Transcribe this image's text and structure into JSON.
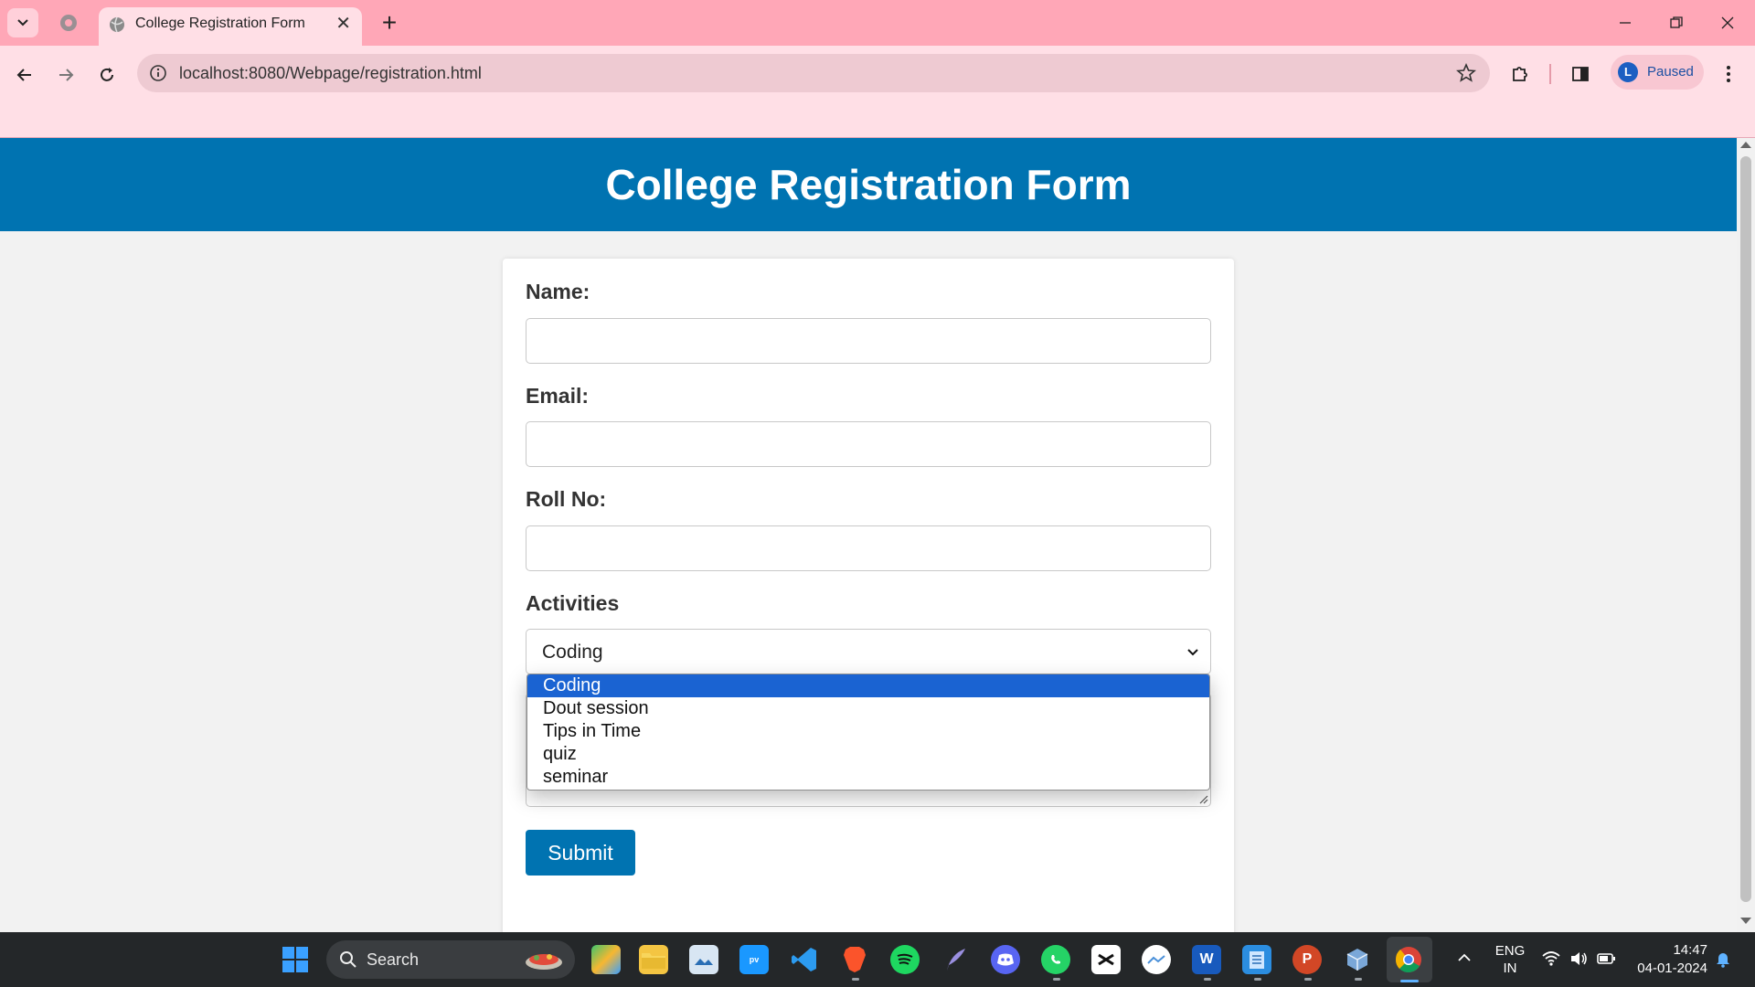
{
  "browser": {
    "tab_title": "College Registration Form",
    "url": "localhost:8080/Webpage/registration.html",
    "profile_initial": "L",
    "profile_status": "Paused"
  },
  "page": {
    "title": "College Registration Form",
    "form": {
      "name_label": "Name:",
      "email_label": "Email:",
      "roll_label": "Roll No:",
      "activities_label": "Activities",
      "activities_selected": "Coding",
      "activities_options": [
        "Coding",
        "Dout session",
        "Tips in Time",
        "quiz",
        "seminar"
      ],
      "submit_label": "Submit"
    }
  },
  "taskbar": {
    "search_label": "Search",
    "lang_line1": "ENG",
    "lang_line2": "IN",
    "time": "14:47",
    "date": "04-01-2024",
    "accent": "#0073b1"
  }
}
